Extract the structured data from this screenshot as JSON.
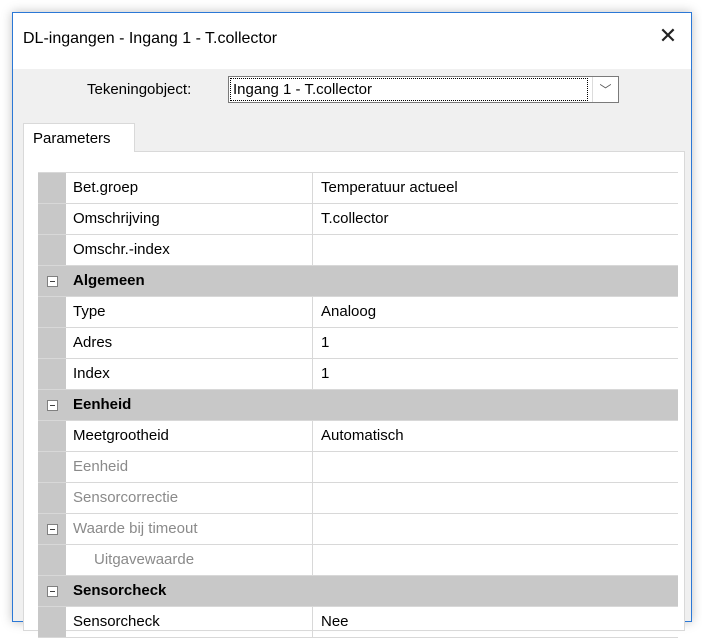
{
  "dialog": {
    "title": "DL-ingangen - Ingang 1 - T.collector",
    "close_glyph": "✕",
    "selector_label": "Tekeningobject:",
    "selector_value": "Ingang 1 - T.collector",
    "selector_arrow": "﹀",
    "tab_label": "Parameters"
  },
  "rows": {
    "r0": {
      "name": "Bet.groep",
      "value": "Temperatuur actueel"
    },
    "r1": {
      "name": "Omschrijving",
      "value": "T.collector"
    },
    "r2": {
      "name": "Omschr.-index",
      "value": ""
    },
    "g1": {
      "label": "Algemeen"
    },
    "r3": {
      "name": "Type",
      "value": "Analoog"
    },
    "r4": {
      "name": "Adres",
      "value": "1"
    },
    "r5": {
      "name": "Index",
      "value": "1"
    },
    "g2": {
      "label": "Eenheid"
    },
    "r6": {
      "name": "Meetgrootheid",
      "value": "Automatisch"
    },
    "r7": {
      "name": "Eenheid",
      "value": ""
    },
    "r8": {
      "name": "Sensorcorrectie",
      "value": ""
    },
    "r9": {
      "name": "Waarde bij timeout",
      "value": ""
    },
    "r10": {
      "name": "Uitgavewaarde",
      "value": ""
    },
    "g3": {
      "label": "Sensorcheck"
    },
    "r11": {
      "name": "Sensorcheck",
      "value": "Nee"
    }
  },
  "icons": {
    "close": "close-icon",
    "dropdown": "chevron-down-icon",
    "collapse": "minus-box-icon"
  },
  "colors": {
    "window_border": "#2b78d6",
    "group_bg": "#c8c8c8",
    "disabled_text": "#8a8a8a"
  }
}
